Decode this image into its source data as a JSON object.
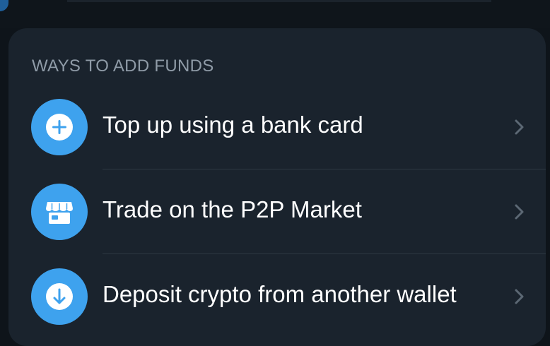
{
  "section": {
    "header": "WAYS TO ADD FUNDS"
  },
  "options": [
    {
      "label": "Top up using a bank card",
      "icon": "plus-circle-icon"
    },
    {
      "label": "Trade on the P2P Market",
      "icon": "store-icon"
    },
    {
      "label": "Deposit crypto from another wallet",
      "icon": "arrow-down-circle-icon"
    }
  ],
  "colors": {
    "background": "#0e141a",
    "card": "#1a232d",
    "icon_bg": "#3ea2ee",
    "header_text": "#8f9ba7",
    "label_text": "#ffffff",
    "chevron": "#5c6874"
  }
}
